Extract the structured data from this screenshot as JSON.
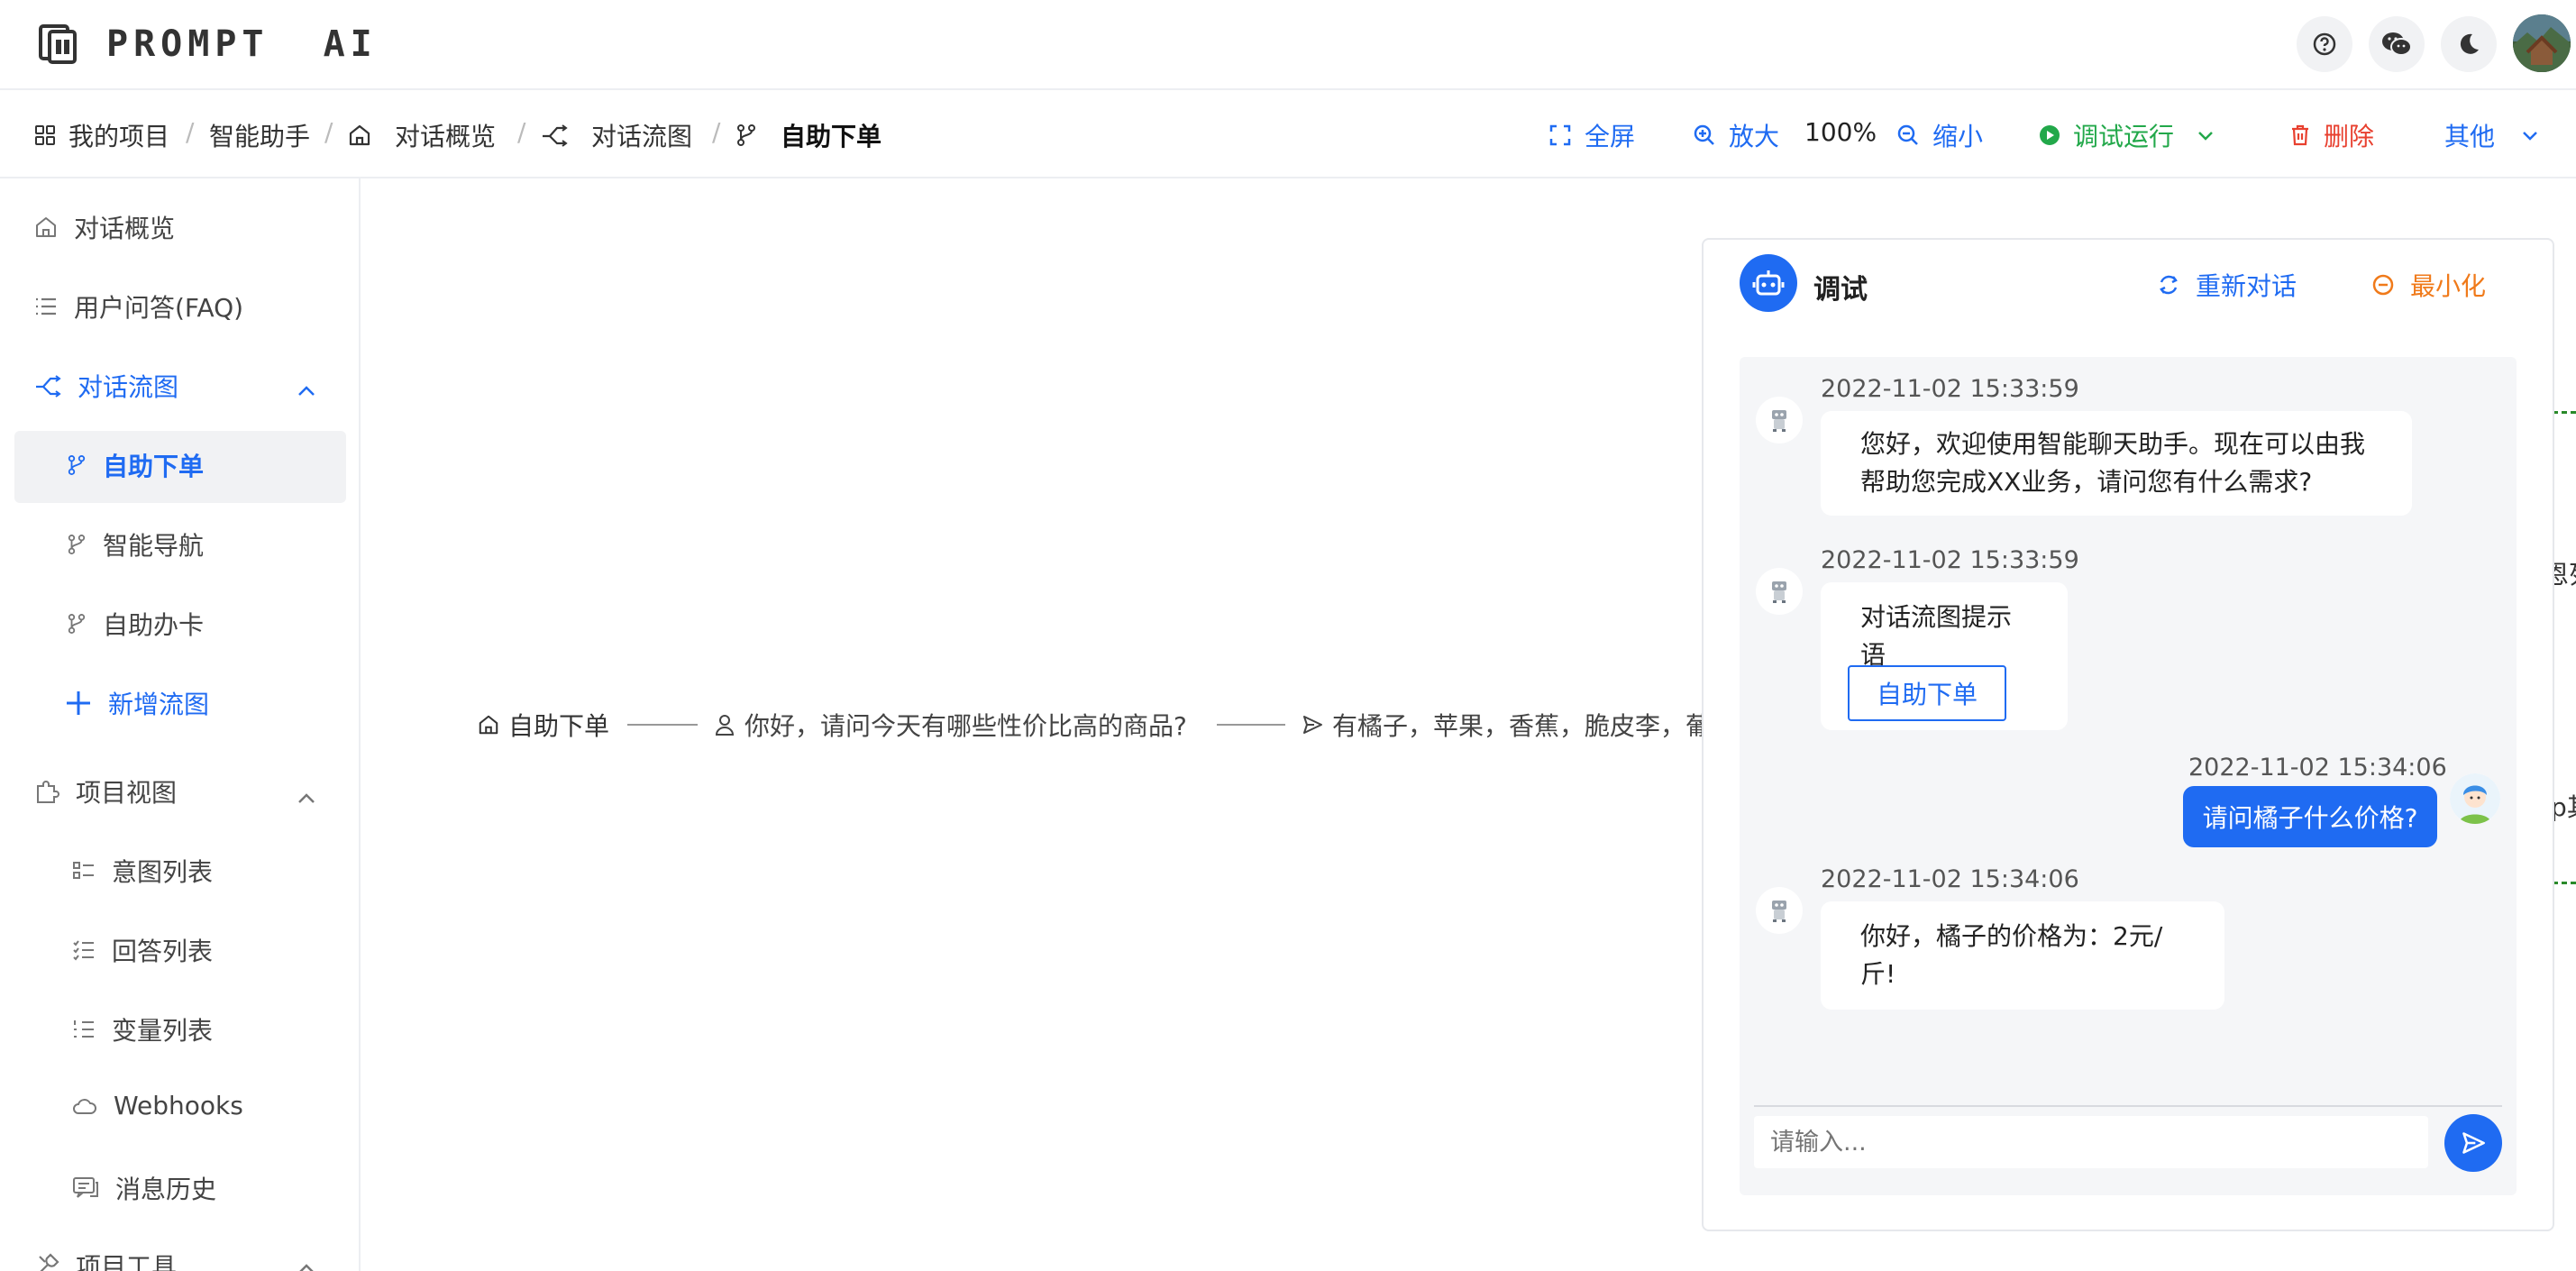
{
  "app": {
    "name": "PROMPT AI"
  },
  "header": {
    "help_icon": "question-circle-icon",
    "wechat_icon": "wechat-icon",
    "theme_icon": "moon-icon",
    "avatar": "user-avatar"
  },
  "breadcrumb": {
    "items": [
      "我的项目",
      "智能助手",
      "对话概览",
      "对话流图",
      "自助下单"
    ]
  },
  "toolbar": {
    "fullscreen": "全屏",
    "zoom_in": "放大",
    "zoom_level": "100%",
    "zoom_out": "缩小",
    "debug_run": "调试运行",
    "delete": "删除",
    "more": "其他"
  },
  "sidebar": {
    "overview": "对话概览",
    "faq": "用户问答(FAQ)",
    "flow_section": "对话流图",
    "flows": [
      "自助下单",
      "智能导航",
      "自助办卡"
    ],
    "add_flow": "新增流图",
    "view_section": "项目视图",
    "views": [
      "意图列表",
      "回答列表",
      "变量列表",
      "Webhooks",
      "消息历史"
    ],
    "tools_section": "项目工具"
  },
  "canvas": {
    "node_start": "自助下单",
    "node_user": "你好，请问今天有哪些性价比高的商品?",
    "node_reply": "有橘子，苹果，香蕉，脆皮李，葡",
    "right_fragment_1": "恩列",
    "right_fragment_2": "p其"
  },
  "debug": {
    "title": "调试",
    "restart": "重新对话",
    "minimize": "最小化",
    "input_placeholder": "请输入...",
    "messages": [
      {
        "from": "bot",
        "time": "2022-11-02 15:33:59",
        "text_line1": "您好，欢迎使用智能聊天助手。现在可以由我",
        "text_line2": "帮助您完成XX业务，请问您有什么需求?"
      },
      {
        "from": "bot",
        "time": "2022-11-02 15:33:59",
        "text": "对话流图提示语",
        "button": "自助下单"
      },
      {
        "from": "user",
        "time": "2022-11-02 15:34:06",
        "text": "请问橘子什么价格?"
      },
      {
        "from": "bot",
        "time": "2022-11-02 15:34:06",
        "text": "你好，橘子的价格为：2元/斤!"
      }
    ]
  },
  "colors": {
    "accent": "#1f6bf2",
    "success": "#22a84a",
    "danger": "#e8402f",
    "warning": "#f07a1a"
  }
}
